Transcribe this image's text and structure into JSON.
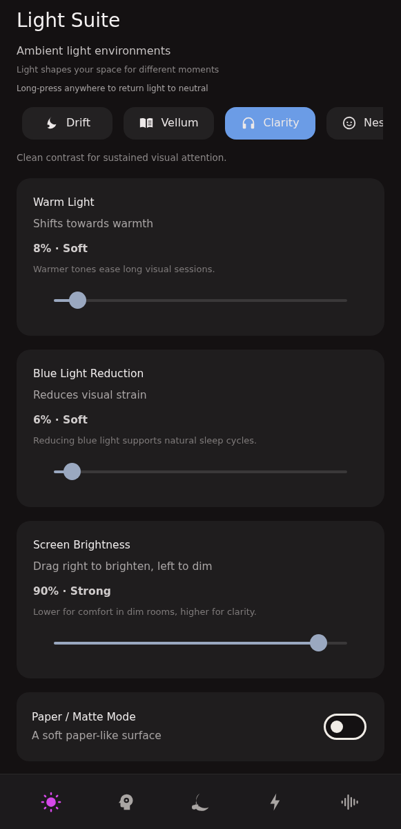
{
  "header": {
    "title": "Light Suite",
    "subtitle": "Ambient light environments",
    "tagline": "Light shapes your space for different moments",
    "hint": "Long-press anywhere to return light to neutral"
  },
  "modes": [
    {
      "kind": "drift",
      "label": "Drift",
      "selected": false
    },
    {
      "kind": "vellum",
      "label": "Vellum",
      "selected": false
    },
    {
      "kind": "clarity",
      "label": "Clarity",
      "selected": true
    },
    {
      "kind": "nest",
      "label": "Nes",
      "selected": false
    }
  ],
  "mode_description": "Clean contrast for sustained visual attention.",
  "controls": [
    {
      "title": "Warm Light",
      "subtitle": "Shifts towards warmth",
      "reading": "8% · Soft",
      "note": "Warmer tones ease long visual sessions.",
      "level": 0.08
    },
    {
      "title": "Blue Light Reduction",
      "subtitle": "Reduces visual strain",
      "reading": "6% · Soft",
      "note": "Reducing blue light supports natural sleep cycles.",
      "level": 0.06
    },
    {
      "title": "Screen Brightness",
      "subtitle": "Drag right to brighten, left to dim",
      "reading": "90% · Strong",
      "note": "Lower for comfort in dim rooms, higher for clarity.",
      "level": 0.9
    }
  ],
  "paper_mode": {
    "title": "Paper / Matte Mode",
    "subtitle": "A soft paper-like surface",
    "on": false
  },
  "bottom_nav": [
    {
      "kind": "sun",
      "selected": true
    },
    {
      "kind": "mind",
      "selected": false
    },
    {
      "kind": "night",
      "selected": false
    },
    {
      "kind": "bolt",
      "selected": false
    },
    {
      "kind": "wave",
      "selected": false
    }
  ]
}
